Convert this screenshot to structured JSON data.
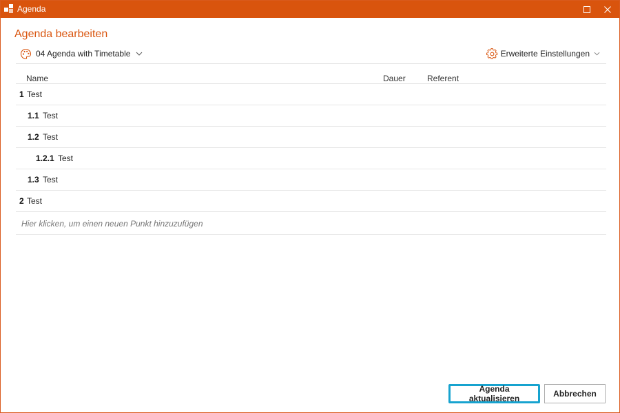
{
  "window": {
    "title": "Agenda"
  },
  "dialog": {
    "heading": "Agenda bearbeiten"
  },
  "template": {
    "label": "04 Agenda with Timetable"
  },
  "settings": {
    "label": "Erweiterte Einstellungen"
  },
  "table": {
    "columns": [
      "Name",
      "Dauer",
      "Referent"
    ],
    "rows": [
      {
        "number": "1",
        "text": "Test",
        "level": 0
      },
      {
        "number": "1.1",
        "text": "Test",
        "level": 1
      },
      {
        "number": "1.2",
        "text": "Test",
        "level": 1
      },
      {
        "number": "1.2.1",
        "text": "Test",
        "level": 2
      },
      {
        "number": "1.3",
        "text": "Test",
        "level": 1
      },
      {
        "number": "2",
        "text": "Test",
        "level": 0
      }
    ],
    "add_hint": "Hier klicken, um einen neuen Punkt hinzuzufügen"
  },
  "buttons": {
    "update": "Agenda aktualisieren",
    "cancel": "Abbrechen"
  },
  "colors": {
    "accent": "#d9540d",
    "focus": "#17a3cf"
  },
  "icons": {
    "app": "agenda-app-icon",
    "maximize": "maximize-icon",
    "close": "close-icon",
    "template": "palette-icon",
    "settings": "gear-icon",
    "dropdown": "chevron-down-icon"
  }
}
